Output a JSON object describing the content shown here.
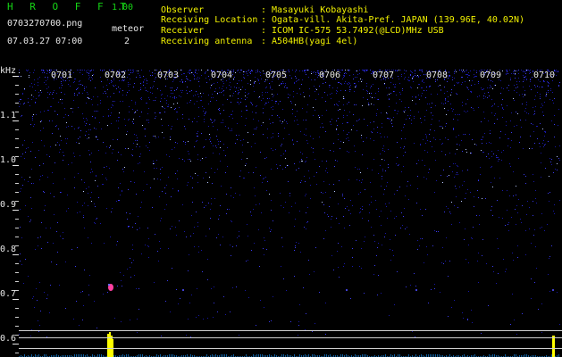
{
  "header": {
    "app_name": "H R O F F T",
    "version": "1.00",
    "filename": "0703270700.png",
    "datetime": "07.03.27 07:00",
    "meteor_label": "meteor",
    "meteor_count": "2",
    "info": [
      {
        "label": "Observer",
        "value": ": Masayuki Kobayashi"
      },
      {
        "label": "Receiving Location",
        "value": ": Ogata-vill. Akita-Pref. JAPAN (139.96E, 40.02N)"
      },
      {
        "label": "Receiver",
        "value": ": ICOM IC-575 53.7492(@LCD)MHz USB"
      },
      {
        "label": "Receiving antenna",
        "value": ": A504HB(yagi 4el)"
      }
    ]
  },
  "spectrogram": {
    "y_unit": "kHz",
    "y_labels": [
      "1.1",
      "1.0",
      "0.9",
      "0.8",
      "0.7",
      "0.6"
    ],
    "minute_labels": [
      "0701",
      "0702",
      "0703",
      "0704",
      "0705",
      "0706",
      "0707",
      "0708",
      "0709",
      "0710"
    ],
    "colors": {
      "background": "#000000",
      "noise": "#1818a8",
      "meteor": "#ff40a0",
      "level": "#ffff00",
      "text_white": "#e8e8e8",
      "text_yellow": "#f2f200",
      "text_green": "#16d616"
    }
  }
}
